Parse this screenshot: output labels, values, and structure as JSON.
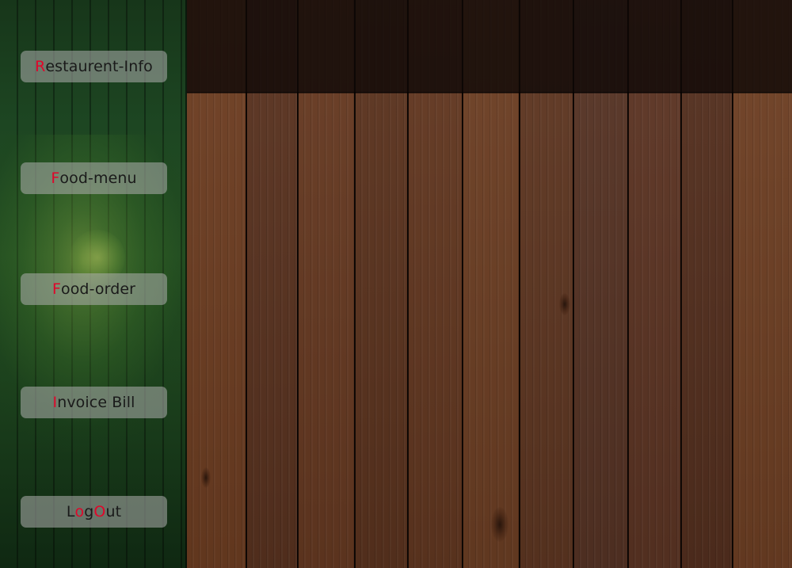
{
  "sidebar": {
    "buttons": [
      {
        "accent": "R",
        "rest": "estaurent-Info"
      },
      {
        "accent": "F",
        "rest": "ood-menu"
      },
      {
        "accent": "F",
        "rest": "ood-order"
      },
      {
        "accent": "I",
        "rest": "nvoice Bill"
      }
    ],
    "logout": {
      "part1": "L",
      "part2": "o",
      "part3": "g",
      "part4": "O",
      "part5": "ut"
    }
  },
  "colors": {
    "accent_letter": "#e0062a",
    "button_bg": "rgba(175,175,175,0.55)",
    "sidebar_green": "#1d4622",
    "wood": "#633821",
    "top_band": "#0e0806"
  }
}
